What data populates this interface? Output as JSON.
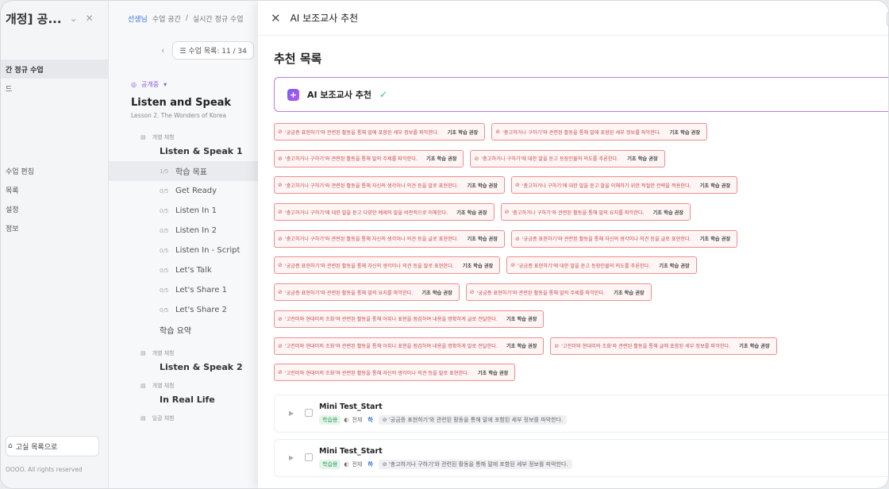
{
  "sidebar": {
    "title": "개정] 공...",
    "items": [
      "간 정규 수업",
      "드",
      "",
      "",
      "수업 편집",
      "목록",
      "설정",
      "정보"
    ],
    "bottom_button": "고실 목록으로",
    "copyright": "OOOO. All rights reserved"
  },
  "middle": {
    "breadcrumb": [
      "선생님",
      "수업 공간",
      "실시간 정규 수업"
    ],
    "nav_label": "수업 목록: 11 / 34",
    "badge": "공개중",
    "title": "Listen and Speak",
    "subtitle": "Lesson 2. The Wonders of Korea",
    "lesson1": {
      "type": "개별 체험",
      "name": "Listen & Speak 1",
      "steps": [
        {
          "count": "1/5",
          "label": "학습 목표"
        },
        {
          "count": "0/5",
          "label": "Get Ready"
        },
        {
          "count": "0/5",
          "label": "Listen In 1"
        },
        {
          "count": "0/5",
          "label": "Listen In 2"
        },
        {
          "count": "0/5",
          "label": "Listen In - Script"
        },
        {
          "count": "0/5",
          "label": "Let's Talk"
        },
        {
          "count": "0/5",
          "label": "Let's Share 1"
        },
        {
          "count": "0/5",
          "label": "Let's Share 2"
        },
        {
          "count": "",
          "label": "학습 요약"
        }
      ]
    },
    "lesson2": {
      "type": "개별 체험",
      "name": "Listen & Speak 2"
    },
    "lesson3": {
      "type": "개별 체험",
      "name": "In Real Life"
    },
    "lesson4": {
      "type": "일괄 체험"
    }
  },
  "panel": {
    "title": "AI 보조교사 추천",
    "section_title": "추천 목록",
    "ai_card_title": "AI 보조교사 추천",
    "recommend_label": "기초 학습 권장",
    "tag_rows": [
      [
        "'궁금증 표현하기'와 관련된 활동을 통해 말에 포함된 세부 정보를 파악한다.",
        "'충고하거나 구하기'와 관련된 활동을 통해 말에 포함된 세부 정보를 파악한다."
      ],
      [
        "'충고하거나 구하기'와 관련된 활동을 통해 말의 주제를 파악한다.",
        "'충고하거나 구하기'에 대한 말을 듣고 등장인물의 의도를 추론한다."
      ],
      [
        "'충고하거나 구하기'와 관련된 활동을 통해 자신의 생각이나 의견 등을 말로 표현한다.",
        "'충고하거나 구하기'에 대한 말을 듣고 말을 이해하기 위한 적절한 전략을 적용한다."
      ],
      [
        "'충고하거나 구하기'에 대한 말을 듣고 다양한 예제의 말을 비판적으로 이해한다.",
        "'충고하거나 구하기'와 관련된 활동을 통해 말의 요지를 파악한다."
      ],
      [
        "'충고하거나 구하기'와 관련된 활동을 통해 자신의 생각이나 의견 등을 글로 표현한다.",
        "'궁금증 표현하기'와 관련된 활동을 통해 자신의 생각이나 의견 등을 글로 표현한다."
      ],
      [
        "'궁금증 표현하기'와 관련된 활동을 통해 자신의 생각이나 의견 등을 말로 표현한다.",
        "'궁금증 표현하기'에 대한 말을 듣고 등장인물의 의도를 추론한다."
      ],
      [
        "'궁금증 표현하기'와 관련된 활동을 통해 말의 요지를 파악한다.",
        "'궁금증 표현하기'와 관련된 활동을 통해 말의 주제를 파악한다."
      ],
      [
        "'고전미와 현대미의 조화'와 관련된 활동을 통해 어휘나 표현을 점검하여 내용을 명확하게 글로 전달한다."
      ],
      [
        "'고전미와 현대미의 조화'와 관련된 활동을 통해 어휘나 표현을 점검하여 내용을 명확하게 말로 전달한다.",
        "'고전미와 현대미의 조화'와 관련된 활동을 통해 글에 포함된 세부 정보를 파악한다."
      ],
      [
        "'고전미와 현대미의 조화'와 관련된 활동을 통해 자신의 생각이나 의견 등을 말로 표현한다."
      ]
    ],
    "mini_tests": [
      {
        "title": "Mini Test_Start",
        "type": "학습용",
        "scope": "전체",
        "level": "하",
        "objective": "'궁금증 표현하기'와 관련된 활동을 통해 말에 포함된 세부 정보를 파악한다."
      },
      {
        "title": "Mini Test_Start",
        "type": "학습용",
        "scope": "전체",
        "level": "하",
        "objective": "'충고하거나 구하기'와 관련된 활동을 통해 말에 포함된 세부 정보를 파악한다."
      }
    ]
  }
}
